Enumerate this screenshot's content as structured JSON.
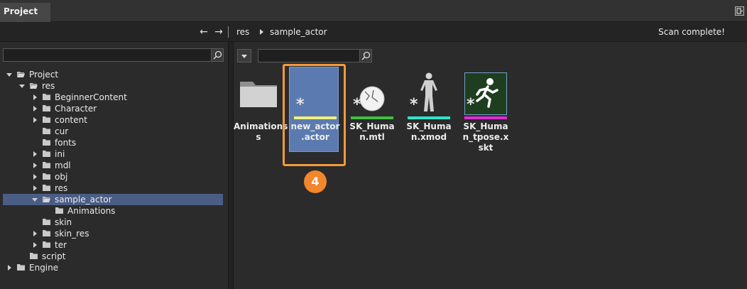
{
  "tab": {
    "label": "Project"
  },
  "toolbar": {
    "back_icon": "←",
    "forward_icon": "→",
    "breadcrumb": [
      "res",
      "sample_actor"
    ],
    "status": "Scan complete!"
  },
  "tree": {
    "items": [
      {
        "label": "Project",
        "depth": 0,
        "state": "expanded",
        "selected": false
      },
      {
        "label": "res",
        "depth": 1,
        "state": "expanded",
        "selected": false
      },
      {
        "label": "BeginnerContent",
        "depth": 2,
        "state": "collapsed",
        "selected": false
      },
      {
        "label": "Character",
        "depth": 2,
        "state": "collapsed",
        "selected": false
      },
      {
        "label": "content",
        "depth": 2,
        "state": "collapsed",
        "selected": false
      },
      {
        "label": "cur",
        "depth": 2,
        "state": "none",
        "selected": false
      },
      {
        "label": "fonts",
        "depth": 2,
        "state": "none",
        "selected": false
      },
      {
        "label": "ini",
        "depth": 2,
        "state": "collapsed",
        "selected": false
      },
      {
        "label": "mdl",
        "depth": 2,
        "state": "collapsed",
        "selected": false
      },
      {
        "label": "obj",
        "depth": 2,
        "state": "collapsed",
        "selected": false
      },
      {
        "label": "res",
        "depth": 2,
        "state": "collapsed",
        "selected": false
      },
      {
        "label": "sample_actor",
        "depth": 2,
        "state": "expanded",
        "selected": true
      },
      {
        "label": "Animations",
        "depth": 3,
        "state": "none",
        "selected": false
      },
      {
        "label": "skin",
        "depth": 2,
        "state": "none",
        "selected": false
      },
      {
        "label": "skin_res",
        "depth": 2,
        "state": "collapsed",
        "selected": false
      },
      {
        "label": "ter",
        "depth": 2,
        "state": "collapsed",
        "selected": false
      },
      {
        "label": "script",
        "depth": 1,
        "state": "none",
        "selected": false
      },
      {
        "label": "Engine",
        "depth": 0,
        "state": "collapsed",
        "selected": false
      }
    ]
  },
  "files": [
    {
      "label_lines": [
        "Animations",
        "s"
      ],
      "kind": "folder",
      "bar_color": "",
      "modified": false,
      "selected": false
    },
    {
      "label_lines": [
        "new_actor",
        ".actor"
      ],
      "kind": "actor",
      "bar_color": "#f2f07a",
      "modified": true,
      "selected": true
    },
    {
      "label_lines": [
        "SK_Huma",
        "n.mtl"
      ],
      "kind": "material",
      "bar_color": "#3fbf3f",
      "modified": true,
      "selected": false
    },
    {
      "label_lines": [
        "SK_Huma",
        "n.xmod"
      ],
      "kind": "model",
      "bar_color": "#2ee6c8",
      "modified": true,
      "selected": false
    },
    {
      "label_lines": [
        "SK_Huma",
        "n_tpose.x",
        "skt"
      ],
      "kind": "skeleton",
      "bar_color": "#e22ad8",
      "modified": true,
      "selected": false
    }
  ],
  "callout": {
    "number": "4"
  },
  "colors": {
    "accent": "#f59a3a",
    "selection": "#4a5d85"
  }
}
